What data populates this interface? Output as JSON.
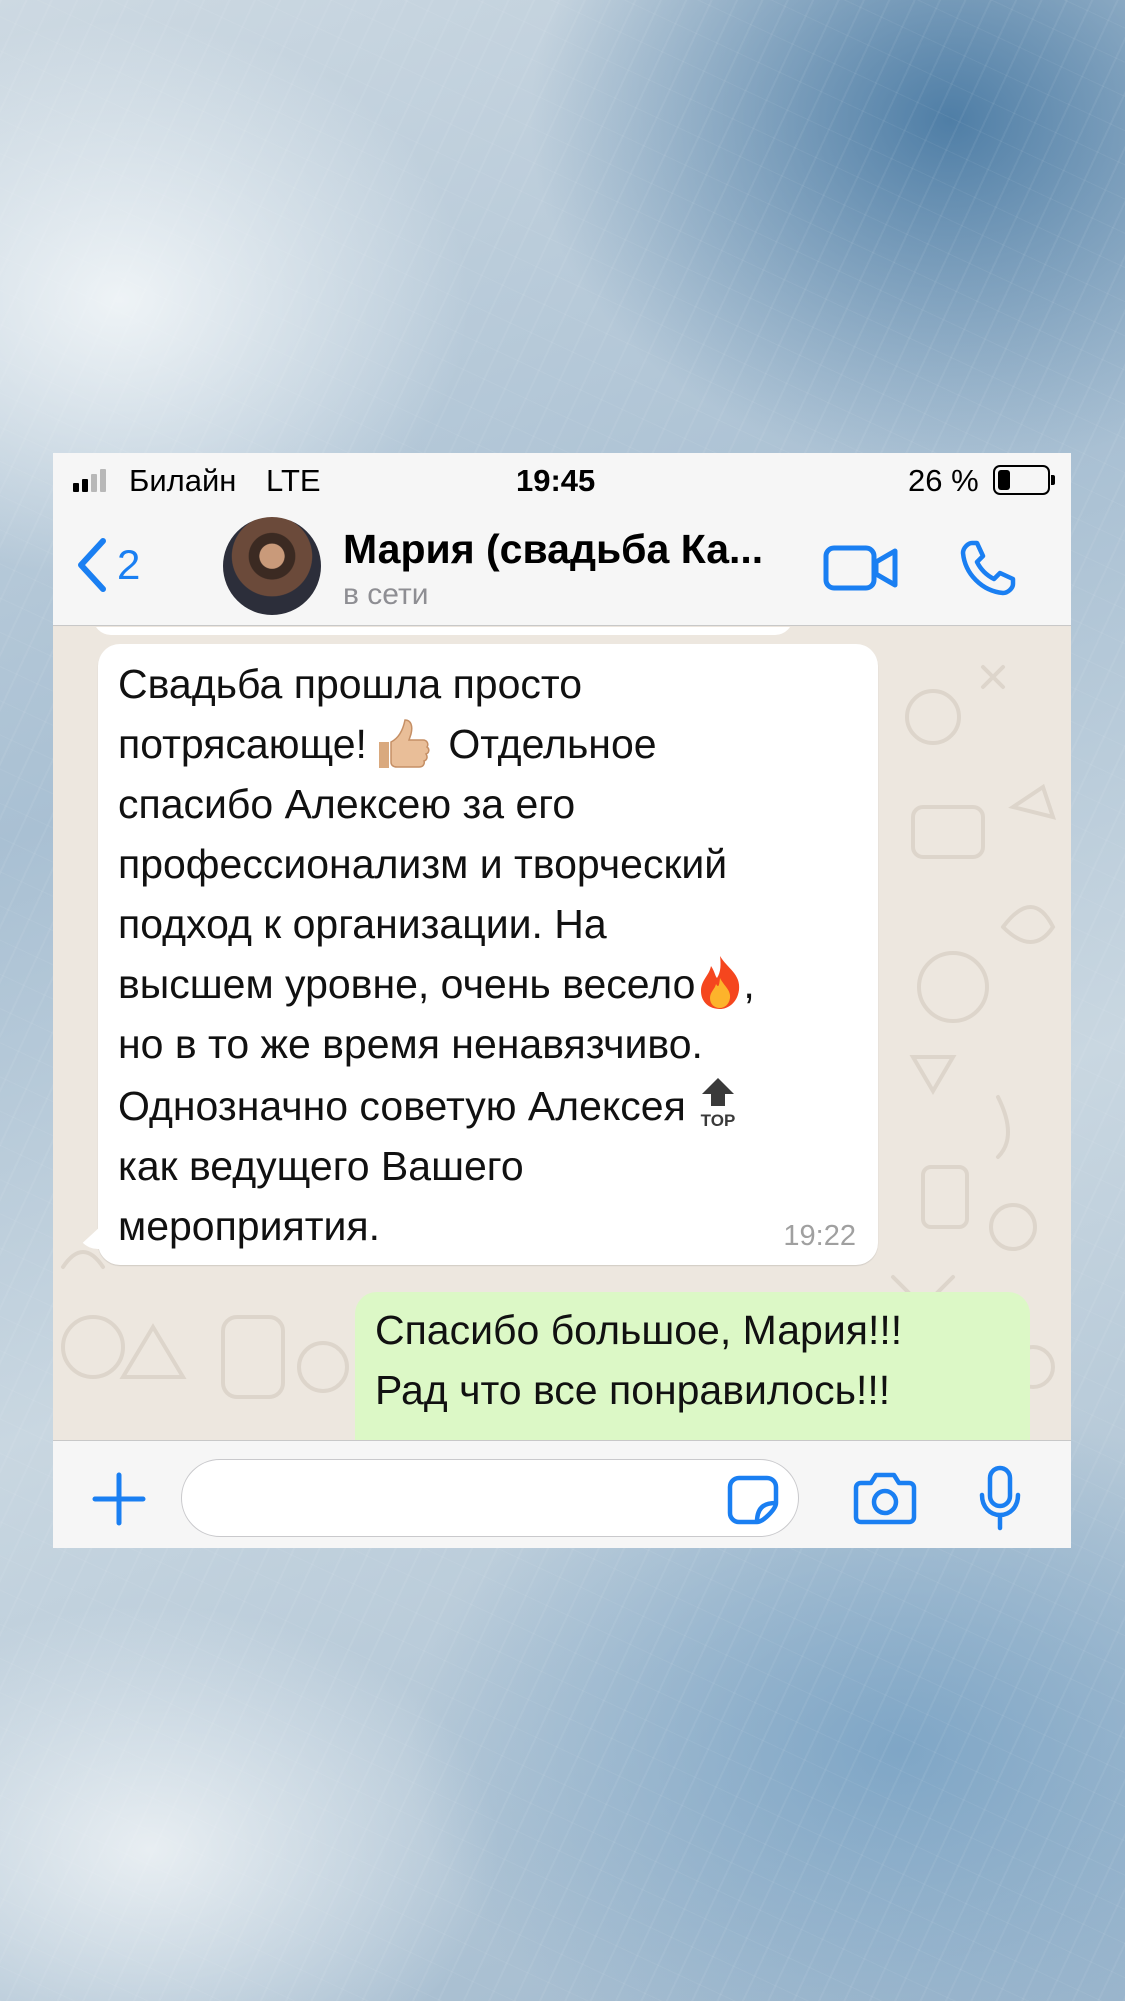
{
  "status_bar": {
    "carrier": "Билайн",
    "network": "LTE",
    "time": "19:45",
    "battery_percent": "26 %",
    "battery_level": 0.26
  },
  "header": {
    "back_count": "2",
    "contact_name": "Мария (свадьба Ка...",
    "contact_status": "в сети",
    "accent_color": "#1a7ff2"
  },
  "messages": [
    {
      "direction": "incoming",
      "text_part1": "Свадьба прошла просто\nпотрясающе!",
      "text_part2": " Отдельное\nспасибо Алексею за его\nпрофессионализм и творческий\nподход к организации. На\nвысшем уровне, очень весело",
      "text_part3": ",\nно в то же время ненавязчиво.\nОднозначно советую Алексея",
      "text_part4": "\nкак ведущего Вашего\nмероприятия.",
      "emojis": [
        "thumbs-up",
        "fire",
        "top-arrow"
      ],
      "emoji_top_label": "TOP",
      "time": "19:22"
    },
    {
      "direction": "outgoing",
      "text": "Спасибо большое, Мария!!!\nРад что все понравилось!!!"
    }
  ],
  "input_bar": {
    "placeholder": ""
  },
  "colors": {
    "incoming_bubble": "#ffffff",
    "outgoing_bubble": "#dcf8c6",
    "chat_background": "#ede7df",
    "bar_background": "#f6f6f6"
  }
}
